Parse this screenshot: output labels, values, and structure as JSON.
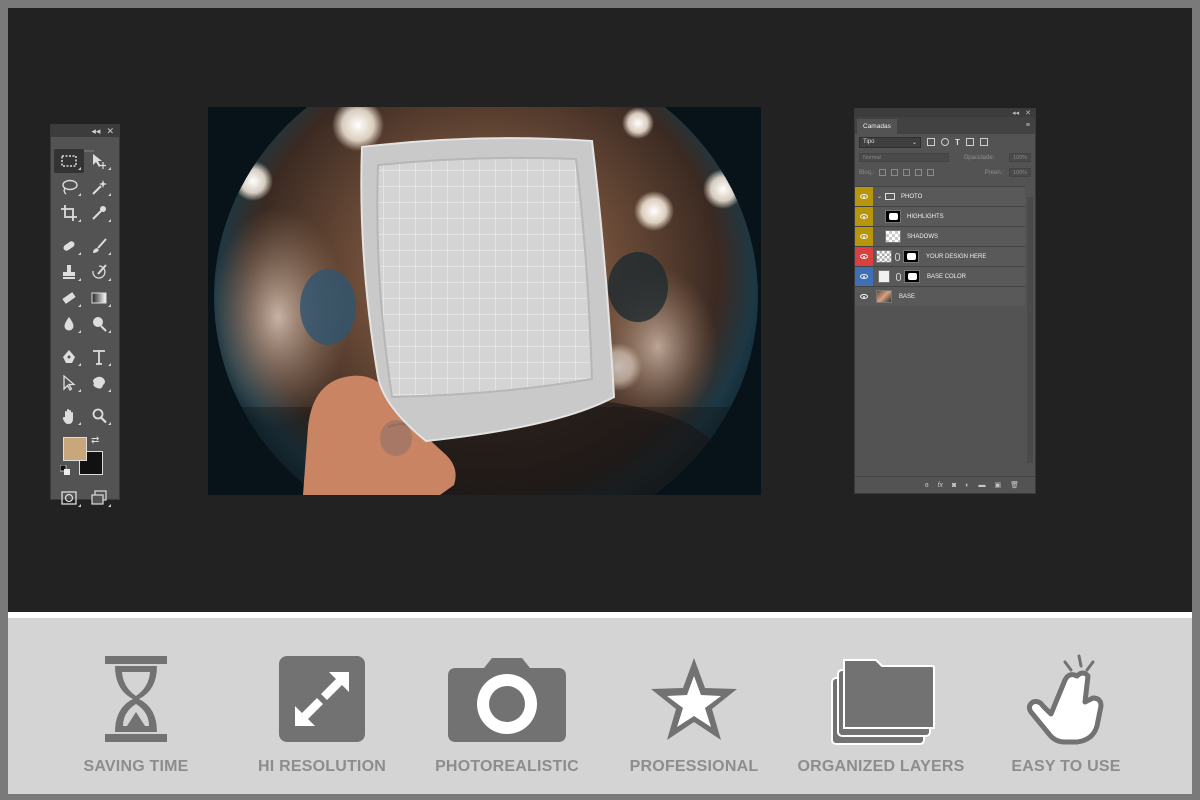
{
  "toolbar": {
    "collapse_glyph": "◂◂",
    "close_glyph": "✕",
    "foreground_color": "#c9a77c",
    "background_color": "#111111",
    "tools": [
      "rectangular-marquee",
      "move",
      "lasso",
      "magic-wand",
      "crop",
      "eyedropper",
      "spot-healing",
      "brush",
      "clone-stamp",
      "history-brush",
      "eraser",
      "gradient",
      "blur",
      "dodge",
      "pen",
      "type",
      "path-selection",
      "custom-shape",
      "hand",
      "zoom",
      "quick-mask",
      "screen-mode"
    ]
  },
  "layers_panel": {
    "tab_label": "Camadas",
    "filter": "Tipo",
    "blend_mode": "Normal",
    "opacity_label": "Opacidade:",
    "opacity_value": "100%",
    "lock_label": "Bloq.:",
    "fill_label": "Preen.:",
    "fill_value": "100%",
    "layers": [
      {
        "name": "PHOTO",
        "color": "#b8960c",
        "type": "group"
      },
      {
        "name": "HIGHLIGHTS",
        "color": "#b8960c",
        "type": "mask"
      },
      {
        "name": "SHADOWS",
        "color": "#b8960c",
        "type": "checker"
      },
      {
        "name": "YOUR DESIGN HERE",
        "color": "#d94040",
        "type": "smart"
      },
      {
        "name": "BASE COLOR",
        "color": "#3f6fb5",
        "type": "fill"
      },
      {
        "name": "BASE",
        "color": "",
        "type": "photo"
      }
    ],
    "footer_glyphs": [
      "ɞ",
      "fx"
    ]
  },
  "features": [
    {
      "label": "SAVING TIME",
      "icon": "hourglass-icon"
    },
    {
      "label": "HI RESOLUTION",
      "icon": "expand-icon"
    },
    {
      "label": "PHOTOREALISTIC",
      "icon": "camera-icon"
    },
    {
      "label": "PROFESSIONAL",
      "icon": "star-icon"
    },
    {
      "label": "ORGANIZED LAYERS",
      "icon": "folders-icon"
    },
    {
      "label": "EASY TO USE",
      "icon": "tap-hand-icon"
    }
  ],
  "colors": {
    "stage": "#222222",
    "panel": "#535353",
    "feature_icon": "#727272",
    "feature_bar": "#d4d4d4"
  }
}
